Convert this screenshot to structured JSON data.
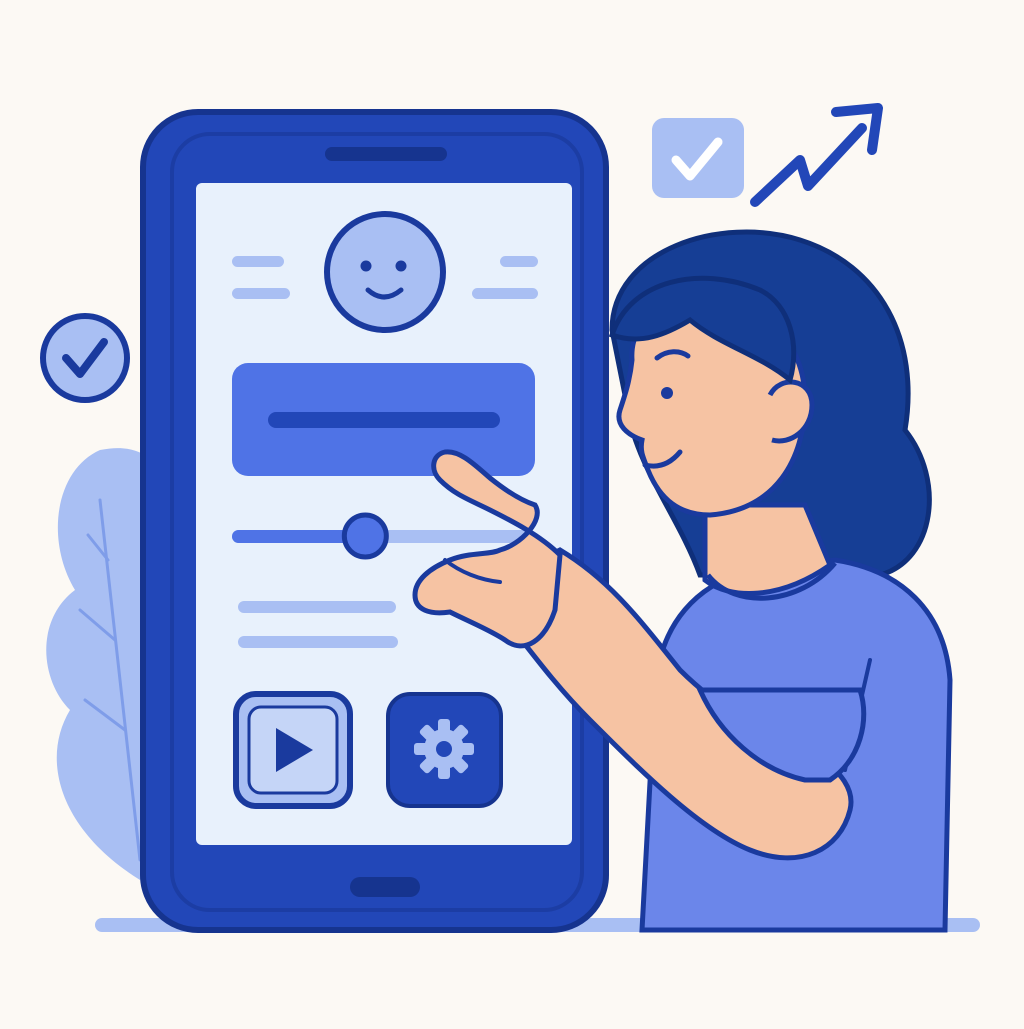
{
  "palette": {
    "background": "#fcf9f4",
    "outline": "#1a3a9e",
    "phone_body": "#2247b8",
    "phone_frame": "#1b3da8",
    "screen": "#e8f1fc",
    "accent": "#4f73e6",
    "light_blue": "#a9bff3",
    "pale_blue": "#c5d5f7",
    "skin": "#f6c3a3",
    "hair": "#163e95",
    "shirt": "#6b86ea"
  },
  "screen": {
    "avatar": {
      "mood": "smiling"
    },
    "slider": {
      "value": 0.44
    },
    "buttons": [
      {
        "icon": "play-icon"
      },
      {
        "icon": "gear-icon"
      }
    ]
  },
  "decorations": {
    "check_badges": [
      "check-square-badge",
      "check-circle-badge"
    ],
    "trend": "trend-up-arrow-icon",
    "plant": "leaf-plant"
  }
}
